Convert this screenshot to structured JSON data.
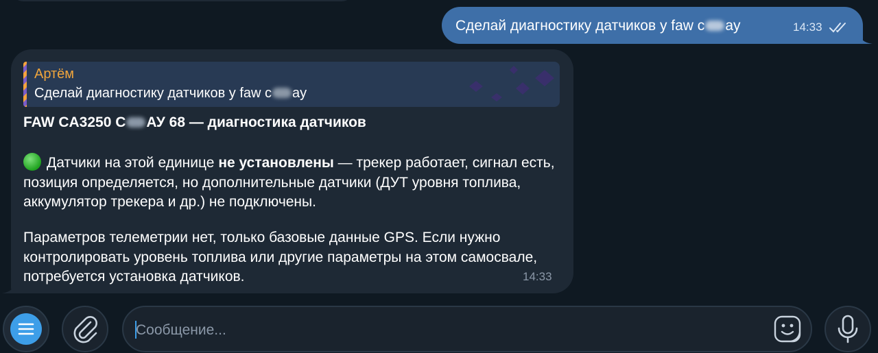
{
  "outgoing": {
    "text_before": "Сделай диагностику датчиков у faw c",
    "text_after": "ay",
    "time": "14:33"
  },
  "incoming": {
    "reply": {
      "author": "Артём",
      "text_before": "Сделай диагностику датчиков у faw c",
      "text_after": "ay"
    },
    "title_before": "FAW CA3250 C",
    "title_after": "АУ 68 — диагностика датчиков",
    "p1_start": "Датчики на этой единице ",
    "p1_bold": "не установлены",
    "p1_end": " — трекер работает, сигнал есть, позиция определяется, но дополнительные датчики (ДУТ уровня топлива, аккумулятор трекера и др.) не подключены.",
    "p2": "Параметров телеметрии нет, только базовые данные GPS. Если нужно контролировать уровень топлива или другие параметры на этом самосвале, потребуется установка датчиков.",
    "time": "14:33"
  },
  "composer": {
    "placeholder": "Сообщение..."
  },
  "icons": {
    "menu": "menu-icon",
    "attach": "paperclip-icon",
    "sticker": "sticker-icon",
    "mic": "microphone-icon",
    "read": "double-check-icon"
  },
  "colors": {
    "background": "#0f1922",
    "outgoing_bubble": "#3e6fa8",
    "incoming_bubble": "#1e2935",
    "accent": "#3d9ee8",
    "author": "#f0a53c"
  }
}
